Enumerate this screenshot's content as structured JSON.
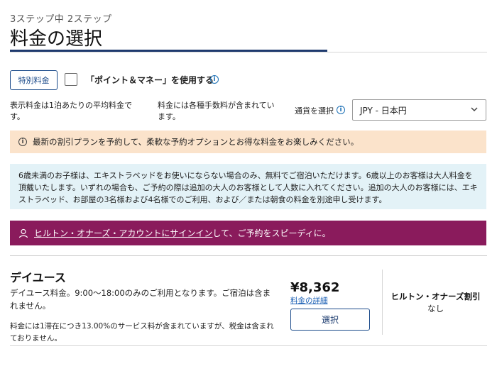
{
  "header": {
    "step": "3ステップ中 2ステップ",
    "title": "料金の選択"
  },
  "options": {
    "special_rates_label": "特別料金",
    "points_money_label": "「ポイント＆マネー」を使用する",
    "points_money_checked": false
  },
  "notes": {
    "average_rate": "表示料金は1泊あたりの平均料金です。",
    "fees_included": "料金には各種手数料が含まれています。"
  },
  "currency": {
    "label": "通貨を選択",
    "selected": "JPY - 日本円"
  },
  "promo_banner": {
    "text": "最新の割引プランを予約して、柔軟な予約オプションとお得な料金をお楽しみください。"
  },
  "children_notice": {
    "text": "6歳未満のお子様は、エキストラベッドをお使いにならない場合のみ、無料でご宿泊いただけます。6歳以上のお客様は大人料金を頂戴いたします。いずれの場合も、ご予約の際は追加の大人のお客様として人数に入れてください。追加の大人のお客様には、エキストラベッド、お部屋の3名様および4名様でのご利用、および／または朝食の料金を別途申し受けます。"
  },
  "signin_banner": {
    "link_text": "ヒルトン・オナーズ・アカウントにサインイン",
    "suffix_text": "して、ご予約をスピーディに。"
  },
  "room": {
    "name": "デイユース",
    "description": "デイユース料金。9:00～18:00のみのご利用となります。ご宿泊は含まれません。",
    "fee_note": "料金には1滞在につき13.00%のサービス料が含まれていますが、税金は含まれておりません。",
    "price": "¥8,362",
    "details_link": "料金の詳細",
    "select_button": "選択",
    "honors_title": "ヒルトン・オナーズ割引",
    "honors_value": "なし"
  },
  "icons": {
    "info": "info-icon",
    "chevron": "chevron-down-icon",
    "person": "person-icon"
  },
  "colors": {
    "accent": "#1e3a6e",
    "promo_bg": "#fbe3cb",
    "notice_bg": "#e3f2f7",
    "signin_bg": "#8a1b5c",
    "link": "#1a5fb4"
  }
}
